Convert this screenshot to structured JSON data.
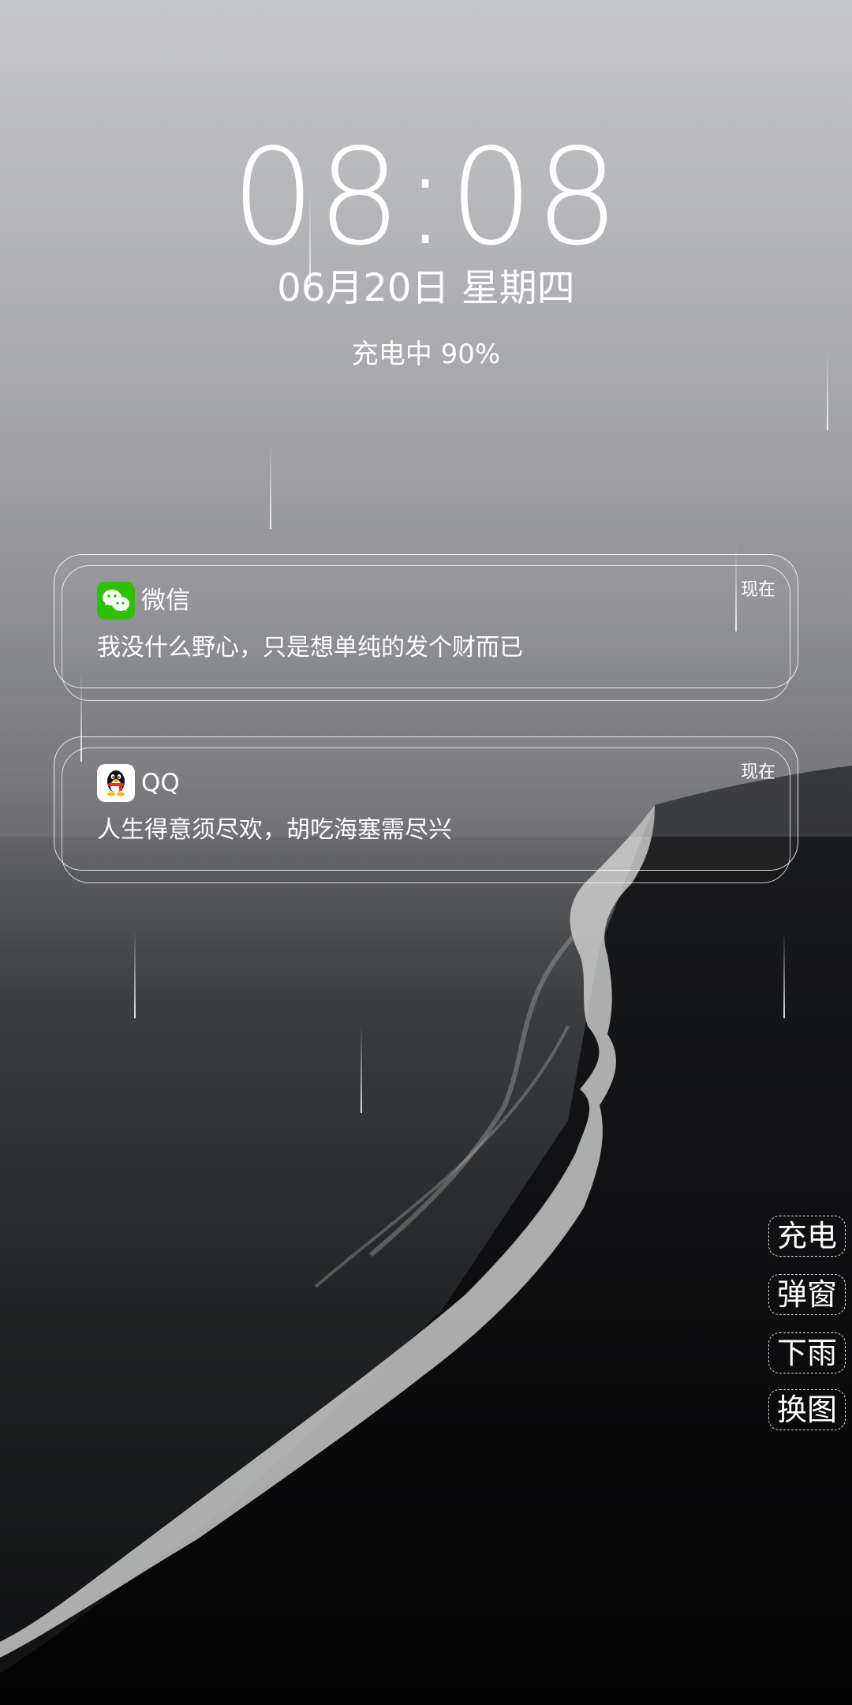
{
  "lockscreen": {
    "time": "08:08",
    "date": "06月20日 星期四",
    "charging_status": "充电中 90%"
  },
  "notifications": [
    {
      "app": "微信",
      "icon": "wechat-icon",
      "time": "现在",
      "message": "我没什么野心，只是想单纯的发个财而已",
      "accent": "#2dc100"
    },
    {
      "app": "QQ",
      "icon": "qq-penguin-icon",
      "time": "现在",
      "message": "人生得意须尽欢，胡吃海塞需尽兴",
      "accent": "#e8302a"
    }
  ],
  "side_buttons": [
    {
      "label": "充电"
    },
    {
      "label": "弹窗"
    },
    {
      "label": "下雨"
    },
    {
      "label": "换图"
    }
  ]
}
